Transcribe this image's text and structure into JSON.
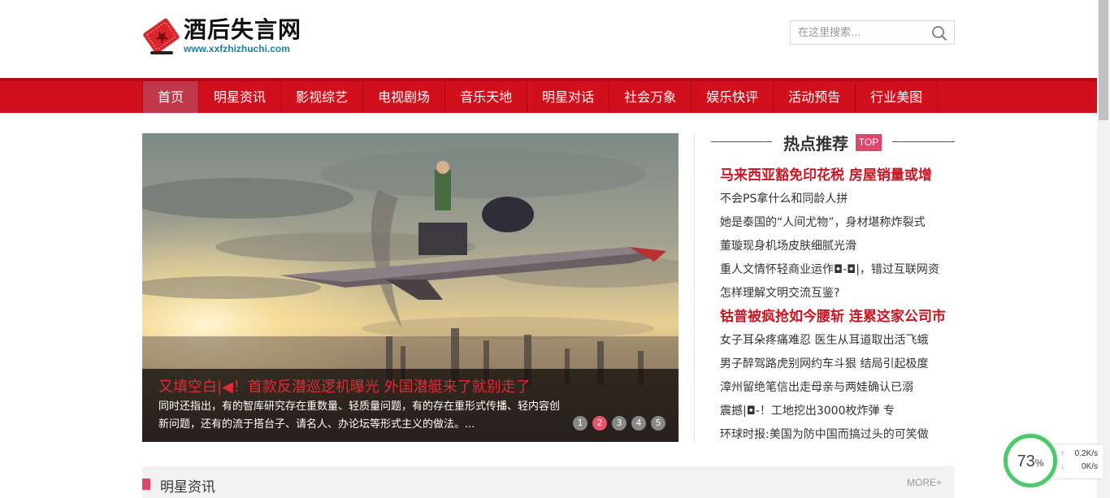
{
  "header": {
    "site_title": "酒后失言网",
    "site_url": "www.xxfzhizhuchi.com",
    "search_placeholder": "在这里搜索..."
  },
  "nav": {
    "items": [
      "首页",
      "明星资讯",
      "影视综艺",
      "电视剧场",
      "音乐天地",
      "明星对话",
      "社会万象",
      "娱乐快评",
      "活动预告",
      "行业美图"
    ],
    "active": "首页"
  },
  "slider": {
    "title": "又填空白|◀！首款反潜巡逻机曝光 外国潜艇来了就别走了",
    "desc": "同时还指出，有的智库研究存在重数量、轻质量问题，有的存在重形式传播、轻内容创新问题，还有的流于搭台子、请名人、办论坛等形式主义的做法。...",
    "dots": [
      "1",
      "2",
      "3",
      "4",
      "5"
    ],
    "active_dot": "2"
  },
  "hot": {
    "title": "热点推荐",
    "badge": "TOP",
    "items": [
      "马来西亚豁免印花税 房屋销量或增",
      "不会PS拿什么和同龄人拼",
      "她是泰国的“人间尤物”，身材堪称炸裂式",
      "董璇现身机场皮肤细腻光滑",
      "重人文情怀轻商业运作◘-◘|，错过互联网资",
      "怎样理解文明交流互鉴?",
      "钴普被疯抢如今腰斩 连累这家公司市",
      "女子耳朵疼痛难忍 医生从耳道取出活飞蛾",
      "男子醉驾路虎别网约车斗狠 结局引起极度",
      "漳州留绝笔信出走母亲与两娃确认已溺",
      "震撼|◘-！工地挖出3000枚炸弹 专",
      "环球时报:美国为防中国而搞过头的可笑做"
    ]
  },
  "section": {
    "title": "明星资讯",
    "more": "MORE+"
  },
  "speed": {
    "percent": "73",
    "percent_sign": "%",
    "up": "0.2K/s",
    "down": "0K/s"
  },
  "colors": {
    "nav_red": "#d20f1d",
    "accent_pink": "#e0466a",
    "headline_red": "#c81623"
  }
}
